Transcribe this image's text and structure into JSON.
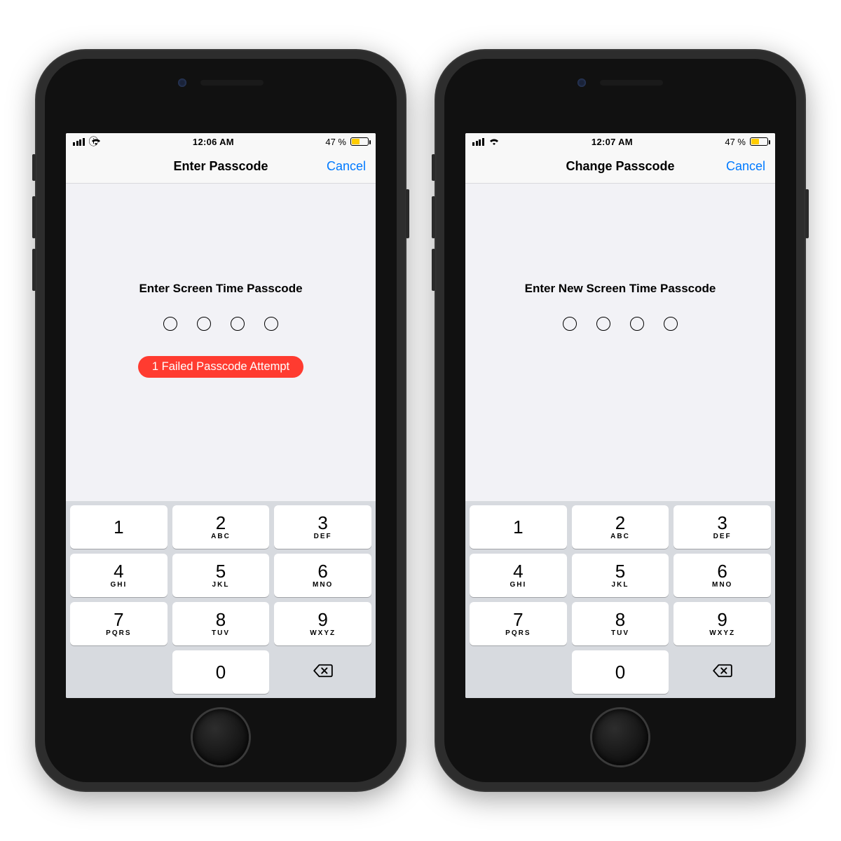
{
  "phones": [
    {
      "status": {
        "time": "12:06 AM",
        "battery_text": "47 %"
      },
      "nav": {
        "title": "Enter Passcode",
        "cancel": "Cancel"
      },
      "prompt": "Enter Screen Time Passcode",
      "fail": "1 Failed Passcode Attempt",
      "show_fail": true
    },
    {
      "status": {
        "time": "12:07 AM",
        "battery_text": "47 %"
      },
      "nav": {
        "title": "Change Passcode",
        "cancel": "Cancel"
      },
      "prompt": "Enter New Screen Time Passcode",
      "fail": "",
      "show_fail": false
    }
  ],
  "keypad": [
    {
      "num": "1",
      "letters": ""
    },
    {
      "num": "2",
      "letters": "ABC"
    },
    {
      "num": "3",
      "letters": "DEF"
    },
    {
      "num": "4",
      "letters": "GHI"
    },
    {
      "num": "5",
      "letters": "JKL"
    },
    {
      "num": "6",
      "letters": "MNO"
    },
    {
      "num": "7",
      "letters": "PQRS"
    },
    {
      "num": "8",
      "letters": "TUV"
    },
    {
      "num": "9",
      "letters": "WXYZ"
    },
    {
      "num": "0",
      "letters": ""
    }
  ]
}
